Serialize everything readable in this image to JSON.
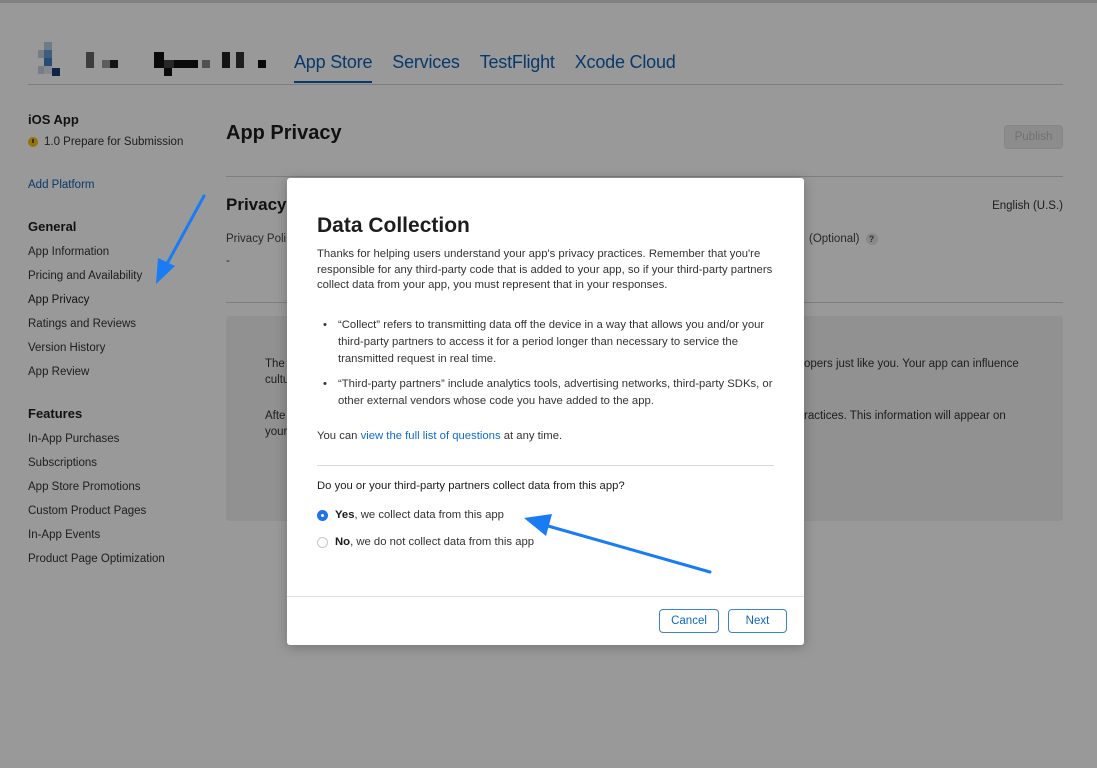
{
  "header": {
    "nav_tabs": [
      {
        "label": "App Store",
        "active": true
      },
      {
        "label": "Services",
        "active": false
      },
      {
        "label": "TestFlight",
        "active": false
      },
      {
        "label": "Xcode Cloud",
        "active": false
      }
    ]
  },
  "sidebar": {
    "app_title": "iOS App",
    "version_status": "1.0 Prepare for Submission",
    "add_platform": "Add Platform",
    "sections": [
      {
        "title": "General",
        "items": [
          {
            "label": "App Information"
          },
          {
            "label": "Pricing and Availability"
          },
          {
            "label": "App Privacy",
            "selected": true
          },
          {
            "label": "Ratings and Reviews"
          },
          {
            "label": "Version History"
          },
          {
            "label": "App Review"
          }
        ]
      },
      {
        "title": "Features",
        "items": [
          {
            "label": "In-App Purchases"
          },
          {
            "label": "Subscriptions"
          },
          {
            "label": "App Store Promotions"
          },
          {
            "label": "Custom Product Pages"
          },
          {
            "label": "In-App Events"
          },
          {
            "label": "Product Page Optimization"
          }
        ]
      }
    ]
  },
  "main": {
    "title": "App Privacy",
    "publish_label": "Publish",
    "privacy_heading": "Privacy",
    "language": "English (U.S.)",
    "privacy_policy_label": "Privacy Poli",
    "privacy_policy_value": "-",
    "optional_label": "(Optional)",
    "help_glyph": "?",
    "info_para1_left": "The",
    "info_para1_left2": "cultu",
    "info_para1_right": "opers just like you. Your app can influence",
    "info_para2_left": "Afte",
    "info_para2_left2": "your",
    "info_para2_right": "ractices. This information will appear on"
  },
  "modal": {
    "title": "Data Collection",
    "intro": "Thanks for helping users understand your app's privacy practices. Remember that you're responsible for any third-party code that is added to your app, so if your third-party partners collect data from your app, you must represent that in your responses.",
    "bullets": [
      "“Collect” refers to transmitting data off the device in a way that allows you and/or your third-party partners to access it for a period longer than necessary to service the transmitted request in real time.",
      "“Third-party partners” include analytics tools, advertising networks, third-party SDKs, or other external vendors whose code you have added to the app."
    ],
    "full_list_prefix": "You can ",
    "full_list_link": "view the full list of questions",
    "full_list_suffix": " at any time.",
    "question": "Do you or your third-party partners collect data from this app?",
    "options": [
      {
        "bold": "Yes",
        "rest": ", we collect data from this app",
        "selected": true
      },
      {
        "bold": "No",
        "rest": ", we do not collect data from this app",
        "selected": false
      }
    ],
    "cancel_label": "Cancel",
    "next_label": "Next"
  },
  "colors": {
    "link_blue": "#0f5fb5",
    "radio_blue": "#1e74e8",
    "annotation_arrow": "#1a7cf5",
    "status_yellow": "#f5c211"
  }
}
